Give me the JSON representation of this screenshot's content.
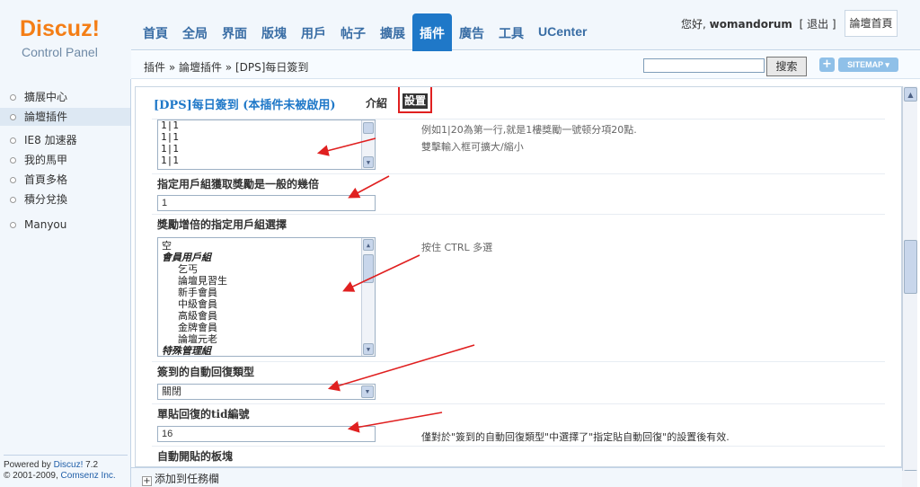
{
  "logo": {
    "main": "Discuz!",
    "sub": "Control Panel"
  },
  "nav": {
    "items": [
      "首頁",
      "全局",
      "界面",
      "版塊",
      "用戶",
      "帖子",
      "擴展",
      "插件",
      "廣告",
      "工具",
      "UCenter"
    ],
    "active": "插件"
  },
  "user": {
    "greeting": "您好,",
    "name": "womandorum",
    "logout": "[ 退出 ]",
    "home": "論壇首頁"
  },
  "breadcrumb": {
    "text": "插件 » 論壇插件 » [DPS]每日簽到"
  },
  "search": {
    "button": "搜索",
    "plus": "+",
    "sitemap": "SITEMAP ▾"
  },
  "sidebar": {
    "items": [
      "擴展中心",
      "論壇插件",
      "IE8 加速器",
      "我的馬甲",
      "首頁多格",
      "積分兌換",
      "Manyou"
    ],
    "active_index": 1,
    "powered_prefix": "Powered by ",
    "powered_product": "Discuz!",
    "powered_version": " 7.2",
    "copyright_prefix": "© 2001-2009, ",
    "copyright_company": "Comsenz Inc."
  },
  "main": {
    "plugin_title": "[DPS]每日簽到 (本插件未被啟用)",
    "tab_intro": "介紹",
    "tab_settings": "設置",
    "reward_lines": [
      "1|1",
      "1|1",
      "1|1",
      "1|1"
    ],
    "reward_hint_1": "例如1|20為第一行,就是1樓獎勵一號顿分項20點.",
    "reward_hint_2": "雙擊輸入框可擴大/縮小",
    "multiplier_label": "指定用戶組獲取獎勵是一般的幾倍",
    "multiplier_value": "1",
    "groups_label": "獎勵增倍的指定用戶組選擇",
    "groups_hint": "按住 CTRL 多選",
    "group_options": [
      {
        "text": "空",
        "type": "plain"
      },
      {
        "text": "會員用戶組",
        "type": "group"
      },
      {
        "text": "乞丐",
        "type": "indent"
      },
      {
        "text": "論壇見習生",
        "type": "indent"
      },
      {
        "text": "新手會員",
        "type": "indent"
      },
      {
        "text": "中級會員",
        "type": "indent"
      },
      {
        "text": "高級會員",
        "type": "indent"
      },
      {
        "text": "金牌會員",
        "type": "indent"
      },
      {
        "text": "論壇元老",
        "type": "indent"
      },
      {
        "text": "特殊管理組",
        "type": "group"
      }
    ],
    "autoreply_label": "簽到的自動回復類型",
    "autoreply_value": "關閉",
    "tid_label": "單貼回復的tid編號",
    "tid_value": "16",
    "tid_hint": "僅對於\"簽到的自動回復類型\"中選擇了\"指定貼自動回復\"的設置後有效.",
    "autopost_label": "自動開貼的板塊"
  },
  "bottombar": {
    "add_task": "添加到任務欄"
  },
  "colors": {
    "accent": "#1f78c8",
    "logo": "#f47e16",
    "annotation": "#e02020"
  }
}
